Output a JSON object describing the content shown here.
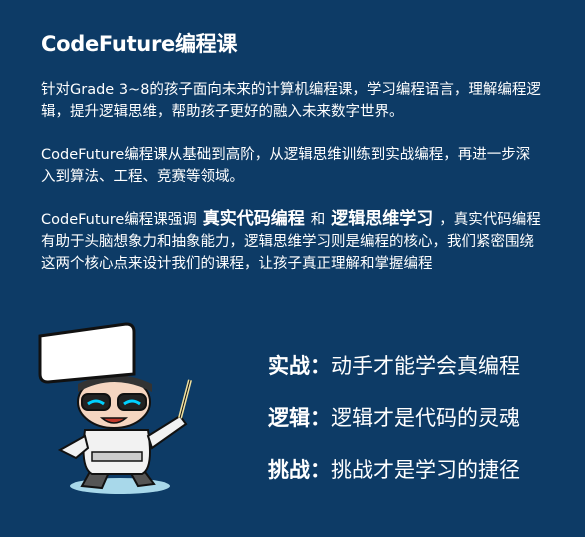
{
  "title": "CodeFuture编程课",
  "paragraphs": {
    "p1": "针对Grade 3~8的孩子面向未来的计算机编程课，学习编程语言，理解编程逻辑，提升逻辑思维，帮助孩子更好的融入未来数字世界。",
    "p2": "CodeFuture编程课从基础到高阶，从逻辑思维训练到实战编程，再进一步深入到算法、工程、竞赛等领域。",
    "p3": {
      "prefix": "CodeFuture编程课强调",
      "highlight1": "真实代码编程",
      "joiner": "和",
      "highlight2": "逻辑思维学习",
      "suffix": "，真实代码编程有助于头脑想象力和抽象能力，逻辑思维学习则是编程的核心，我们紧密围绕这两个核心点来设计我们的课程，让孩子真正理解和掌握编程"
    }
  },
  "slogans": [
    {
      "key": "实战：",
      "text": "动手才能学会真编程"
    },
    {
      "key": "逻辑：",
      "text": "逻辑才是代码的灵魂"
    },
    {
      "key": "挑战：",
      "text": "挑战才是学习的捷径"
    }
  ],
  "colors": {
    "background": "#0d3b66",
    "text": "#ffffff"
  }
}
